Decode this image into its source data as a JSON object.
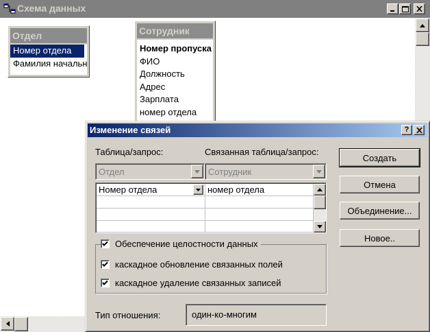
{
  "main_window": {
    "title": "Схема данных",
    "controls": {
      "minimize": "_",
      "maximize": "□",
      "close": "×"
    }
  },
  "diagram": {
    "tables": [
      {
        "title": "Отдел",
        "fields": [
          "Номер отдела",
          "Фамилия начальника"
        ],
        "selected_index": 0
      },
      {
        "title": "Сотрудник",
        "fields": [
          "Номер пропуска",
          "ФИО",
          "Должность",
          "Адрес",
          "Зарплата",
          "номер отдела"
        ],
        "key_index": 0
      }
    ]
  },
  "dialog": {
    "title": "Изменение связей",
    "help_button": "?",
    "close_button": "×",
    "table_label": "Таблица/запрос:",
    "related_label": "Связанная таблица/запрос:",
    "table_value": "Отдел",
    "related_value": "Сотрудник",
    "grid_rows": [
      {
        "left": "Номер отдела",
        "right": "номер отдела"
      },
      {
        "left": "",
        "right": ""
      },
      {
        "left": "",
        "right": ""
      },
      {
        "left": "",
        "right": ""
      }
    ],
    "buttons": {
      "create": "Создать",
      "cancel": "Отмена",
      "join": "Объединение...",
      "new": "Новое.."
    },
    "checkboxes": {
      "integrity": {
        "label": "Обеспечение целостности данных",
        "checked": true
      },
      "cascade_update": {
        "label": "каскадное обновление связанных полей",
        "checked": true
      },
      "cascade_delete": {
        "label": "каскадное удаление связанных записей",
        "checked": true
      }
    },
    "relation_type_label": "Тип отношения:",
    "relation_type_value": "один-ко-многим"
  },
  "colors": {
    "active_title_start": "#0a246a",
    "active_title_end": "#a6caf0",
    "inactive_title": "#808080",
    "face": "#d4d0c8"
  }
}
